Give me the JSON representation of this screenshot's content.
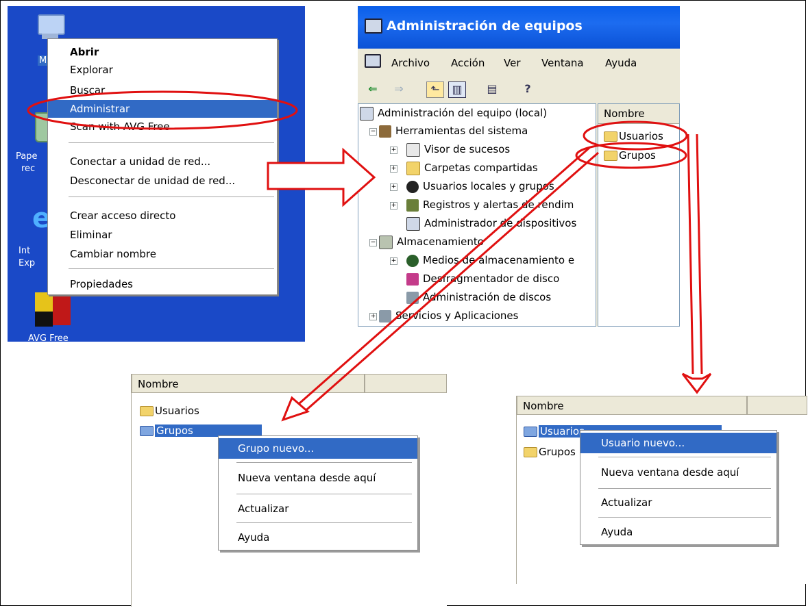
{
  "desktop": {
    "icons": [
      {
        "label": "Mi PC",
        "icon": "my-computer-icon"
      },
      {
        "label": "Papelera de reciclaje",
        "icon": "recycle-bin-icon"
      },
      {
        "label": "Internet Explorer",
        "icon": "internet-explorer-icon"
      },
      {
        "label": "AVG Free",
        "icon": "avg-free-icon"
      }
    ],
    "icon_fragments": {
      "mi": "M",
      "pap1": "Pape",
      "pap2": "rec",
      "int1": "Int",
      "int2": "Exp"
    },
    "context_menu": {
      "items": [
        "Abrir",
        "Explorar",
        "Buscar...",
        "Administrar",
        "Scan with AVG Free",
        "Conectar a unidad de red...",
        "Desconectar de unidad de red...",
        "Crear acceso directo",
        "Eliminar",
        "Cambiar nombre",
        "Propiedades"
      ],
      "selected": "Administrar"
    }
  },
  "mmc": {
    "title": "Administración de equipos",
    "menu": [
      "Archivo",
      "Acción",
      "Ver",
      "Ventana",
      "Ayuda"
    ],
    "tree": {
      "root": "Administración del equipo (local)",
      "system_tools": "Herramientas del sistema",
      "event_viewer": "Visor de sucesos",
      "shared_folders": "Carpetas compartidas",
      "local_users": "Usuarios locales y grupos",
      "perf_logs": "Registros y alertas de rendim",
      "device_manager": "Administrador de dispositivos",
      "storage": "Almacenamiento",
      "removable": "Medios de almacenamiento e",
      "defrag": "Desfragmentador de disco",
      "disk_mgmt": "Administración de discos",
      "services": "Servicios y Aplicaciones"
    },
    "list": {
      "header": "Nombre",
      "items": [
        "Usuarios",
        "Grupos"
      ]
    }
  },
  "panel_groups": {
    "header": "Nombre",
    "items": [
      "Usuarios",
      "Grupos"
    ],
    "selected": "Grupos",
    "menu": [
      "Grupo nuevo...",
      "Nueva ventana desde aquí",
      "Actualizar",
      "Ayuda"
    ]
  },
  "panel_users": {
    "header": "Nombre",
    "items": [
      "Usuarios",
      "Grupos"
    ],
    "selected": "Usuarios",
    "menu": [
      "Usuario nuevo...",
      "Nueva ventana desde aquí",
      "Actualizar",
      "Ayuda"
    ]
  },
  "colors": {
    "desktop": "#1a49c7",
    "selection": "#316ac5",
    "annotation": "#e01010",
    "titlebar": "#0a5fea"
  }
}
